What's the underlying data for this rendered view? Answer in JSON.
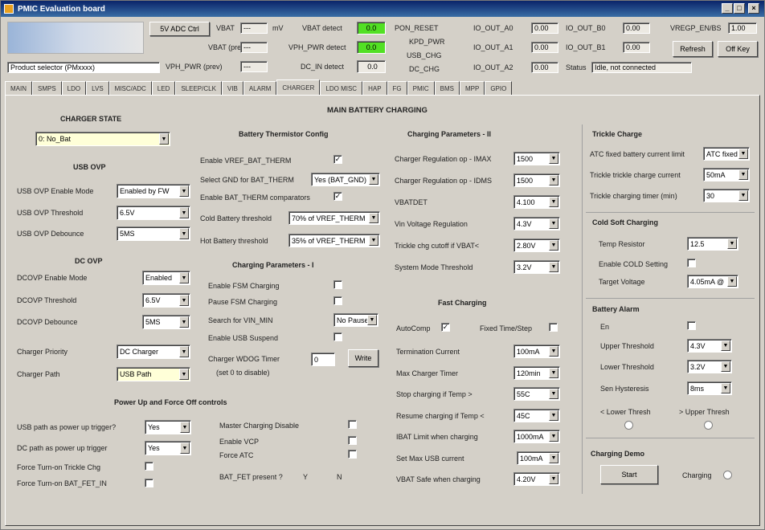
{
  "window": {
    "title": "PMIC Evaluation board",
    "minimize": "_",
    "maximize": "□",
    "close": "×"
  },
  "header": {
    "logo": "PMIC",
    "btn_dcdc": "5V ADC Ctrl",
    "vbat_label": "VBAT",
    "vbat_value": "---",
    "vbat_unit": "mV",
    "vbat_prev_label": "VBAT (prev)",
    "vbat_prev_value": "---",
    "vpwr_prev_label": "VPH_PWR (prev)",
    "vpwr_prev_value": "---",
    "product_label": "PRODUCT",
    "product_value": "Product selector (PMxxxx)",
    "vbat_detect_label": "VBAT detect",
    "vbat_detect_value": "0.0",
    "vphpwr_detect_label": "VPH_PWR detect",
    "vphpwr_detect_value": "0.0",
    "dc_in_detect_label": "DC_IN detect",
    "dc_in_detect_value": "0.0",
    "pon_reset": "PON_RESET",
    "kpd_pwr": "KPD_PWR",
    "usb_chg": "USB_CHG",
    "dc_chg": "DC_CHG",
    "io_out_a0_label": "IO_OUT_A0",
    "io_out_a0_value": "0.00",
    "io_out_b0_label": "IO_OUT_B0",
    "io_out_b0_value": "0.00",
    "io_out_a1_label": "IO_OUT_A1",
    "io_out_a1_value": "0.00",
    "io_out_b1_label": "IO_OUT_B1",
    "io_out_b1_value": "0.00",
    "io_out_a2_label": "IO_OUT_A2",
    "io_out_a2_value": "0.00",
    "vregp_label": "VREGP_EN/BS",
    "vregp_value": "1.00",
    "status_label": "Status",
    "status_value": "Idle, not connected",
    "refresh_button": "Refresh",
    "stop_button": "Off Key"
  },
  "tabs": [
    "MAIN",
    "SMPS",
    "LDO",
    "LVS",
    "MISC/ADC",
    "LED",
    "SLEEP/CLK",
    "VIB",
    "ALARM",
    "CHARGER",
    "LDO MISC",
    "HAP",
    "FG",
    "PMIC",
    "BMS",
    "MPP",
    "GPIO"
  ],
  "active_tab": "CHARGER",
  "page_title": "MAIN BATTERY CHARGING",
  "charger_state": {
    "title": "CHARGER STATE",
    "value": "0: No_Bat"
  },
  "usb_ovp": {
    "title": "USB OVP",
    "enable_label": "USB OVP Enable Mode",
    "enable_value": "Enabled by FW",
    "threshold_label": "USB OVP Threshold",
    "threshold_value": "6.5V",
    "debounce_label": "USB OVP Debounce",
    "debounce_value": "5MS"
  },
  "dc_ovp": {
    "title": "DC OVP",
    "enable_label": "DCOVP Enable Mode",
    "enable_value": "Enabled",
    "threshold_label": "DCOVP Threshold",
    "threshold_value": "6.5V",
    "debounce_label": "DCOVP Debounce",
    "debounce_value": "5MS"
  },
  "charger_priority": {
    "label": "Charger Priority",
    "value": "DC Charger"
  },
  "charger_path": {
    "label": "Charger Path",
    "value": "USB Path"
  },
  "power_up": {
    "title": "Power Up and Force Off controls",
    "usb_label": "USB path as power up trigger?",
    "usb_value": "Yes",
    "dc_label": "DC path as power up trigger",
    "dc_value": "Yes",
    "turnon_label": "Force Turn-on Trickle Chg",
    "turnon_batfet_label": "Force Turn-on BAT_FET_IN",
    "master_label": "Master Charging Disable",
    "enable_vcp_label": "Enable VCP",
    "force_atc_label": "Force ATC",
    "bat_fet_label": "BAT_FET present ?",
    "bat_fet_y": "Y",
    "bat_fet_n": "N"
  },
  "thermistor": {
    "title": "Battery Thermistor Config",
    "enable_label": "Enable VREF_BAT_THERM",
    "select_label": "Select GND for BAT_THERM",
    "select_value": "Yes (BAT_GND)",
    "comparator_label": "Enable BAT_THERM comparators",
    "cold_label": "Cold Battery threshold",
    "cold_value": "70% of VREF_THERM",
    "hot_label": "Hot Battery threshold",
    "hot_value": "35% of VREF_THERM"
  },
  "charge_params_1": {
    "title": "Charging Parameters - I",
    "pause_label": "Enable FSM Charging",
    "pause_fsm_label": "Pause FSM Charging",
    "search_label": "Search for VIN_MIN",
    "search_value": "No Pause",
    "enable_usb_label": "Enable USB Suspend",
    "wdog_label": "Charger WDOG Timer",
    "wdog_sub": "(set 0 to disable)",
    "wdog_value": "0",
    "write_button": "Write"
  },
  "charge_params_2": {
    "title": "Charging Parameters - II",
    "vmax_label": "Charger Regulation op - IMAX",
    "vmax_value": "1500",
    "vdd_label": "Charger Regulation op - IDMS",
    "vdd_value": "1500",
    "vbat_det_label": "VBATDET",
    "vbat_det_value": "4.100",
    "vin_reg_label": "Vin Voltage Regulation",
    "vin_reg_value": "4.3V",
    "trickle_label": "Trickle chg cutoff if VBAT<",
    "trickle_value": "2.80V",
    "safe_label": "System Mode Threshold",
    "safe_value": "3.2V"
  },
  "fast_charging": {
    "title": "Fast Charging",
    "auto_label": "AutoComp",
    "fixed_label": "Fixed Time/Step",
    "term_label": "Termination Current",
    "term_value": "100mA",
    "max_timer_label": "Max Charger Timer",
    "max_timer_value": "120min",
    "stop_label": "Stop charging if Temp >",
    "stop_value": "55C",
    "resume_label": "Resume charging if Temp <",
    "resume_value": "45C",
    "ibat_label": "IBAT Limit when charging",
    "ibat_value": "1000mA",
    "iusb_label": "Set Max USB current",
    "iusb_value": "100mA",
    "vbat_safe_label": "VBAT Safe when charging",
    "vbat_safe_value": "4.20V"
  },
  "trickle": {
    "title": "Trickle Charge",
    "ibat_label": "ATC fixed battery current limit",
    "ibat_value": "ATC fixed",
    "trickle_cur_label": "Trickle trickle charge current",
    "trickle_cur_value": "50mA",
    "timer_label": "Trickle charging timer (min)",
    "timer_value": "30"
  },
  "cold_soft": {
    "title": "Cold Soft Charging",
    "temp_label": "Temp Resistor",
    "temp_value": "12.5",
    "enable_label": "Enable COLD Setting",
    "target_label": "Target Voltage",
    "target_value": "4.05mA @"
  },
  "battery_alarm": {
    "title": "Battery Alarm",
    "en_label": "En",
    "upper_label": "Upper Threshold",
    "upper_value": "4.3V",
    "lower_label": "Lower Threshold",
    "lower_value": "3.2V",
    "hyst_label": "Sen Hysteresis",
    "hyst_value": "8ms",
    "lower_thresh_label": "< Lower Thresh",
    "upper_thresh_label": "> Upper Thresh"
  },
  "charging_demo": {
    "title": "Charging Demo",
    "start_button": "Start",
    "charging_label": "Charging"
  }
}
